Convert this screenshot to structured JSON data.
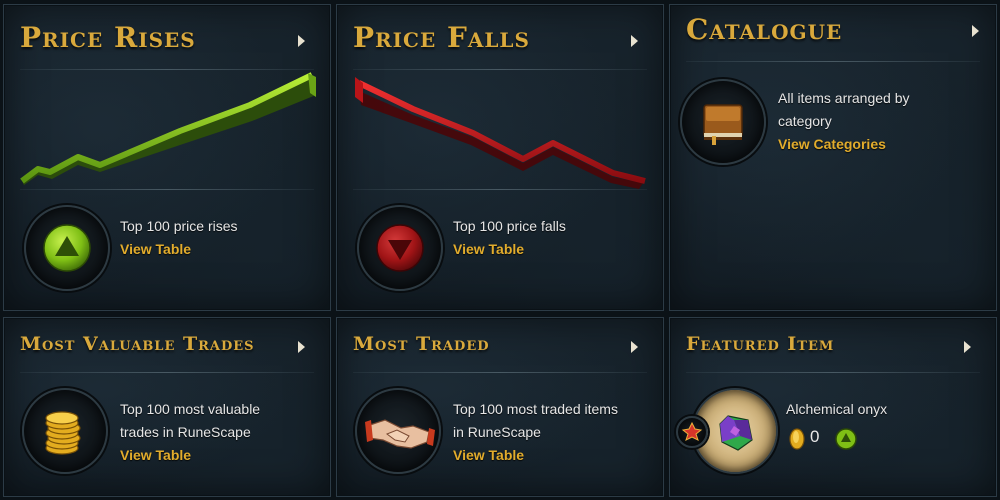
{
  "panels": {
    "price_rises": {
      "title": "Price Rises",
      "description": "Top 100 price rises",
      "link": "View Table",
      "colors": {
        "accent": "#8dcf1f"
      }
    },
    "price_falls": {
      "title": "Price Falls",
      "description": "Top 100 price falls",
      "link": "View Table",
      "colors": {
        "accent": "#c0181b"
      }
    },
    "catalogue": {
      "title": "Catalogue",
      "description_line1": "All items arranged by",
      "description_line2": "category",
      "link": "View Categories",
      "icon": "book-icon"
    },
    "most_valuable_trades": {
      "title": "Most Valuable Trades",
      "description_line1": "Top 100 most valuable",
      "description_line2": "trades in RuneScape",
      "link": "View Table",
      "icon": "gold-coins-icon"
    },
    "most_traded": {
      "title": "Most Traded",
      "description_line1": "Top 100 most traded items",
      "description_line2": "in RuneScape",
      "link": "View Table",
      "icon": "handshake-icon"
    },
    "featured_item": {
      "title": "Featured Item",
      "item_name": "Alchemical onyx",
      "price": "0",
      "icon": "alchemical-onyx-icon",
      "trend_icon": "price-rise-icon"
    }
  }
}
